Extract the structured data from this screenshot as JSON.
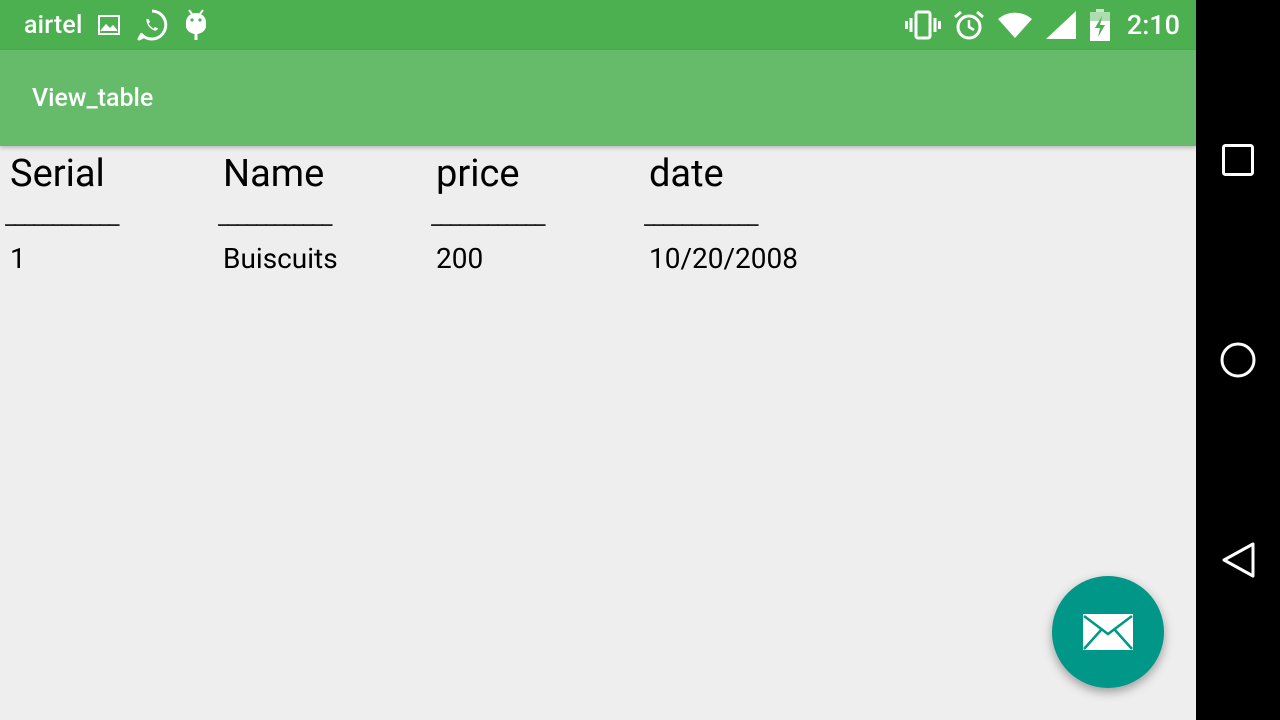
{
  "status_bar": {
    "carrier": "airtel",
    "time": "2:10",
    "left_icons": [
      "image-icon",
      "whatsapp-icon",
      "android-debug-icon"
    ],
    "right_icons": [
      "vibrate-icon",
      "alarm-icon",
      "wifi-icon",
      "signal-icon",
      "battery-charging-icon"
    ]
  },
  "app_bar": {
    "title": "View_table"
  },
  "table": {
    "headers": [
      "Serial",
      "Name",
      "price",
      "date"
    ],
    "separators": [
      "____________",
      "____________",
      "____________",
      "____________"
    ],
    "rows": [
      [
        "1",
        "Buiscuits",
        "200",
        "10/20/2008"
      ]
    ]
  },
  "fab": {
    "icon": "email-icon"
  },
  "nav_bar": {
    "buttons": [
      "recents-icon",
      "home-icon",
      "back-icon"
    ]
  },
  "colors": {
    "status_bar": "#4caf50",
    "app_bar": "#66bb6a",
    "background": "#eeeeee",
    "fab": "#009688",
    "nav_bar": "#000000"
  }
}
